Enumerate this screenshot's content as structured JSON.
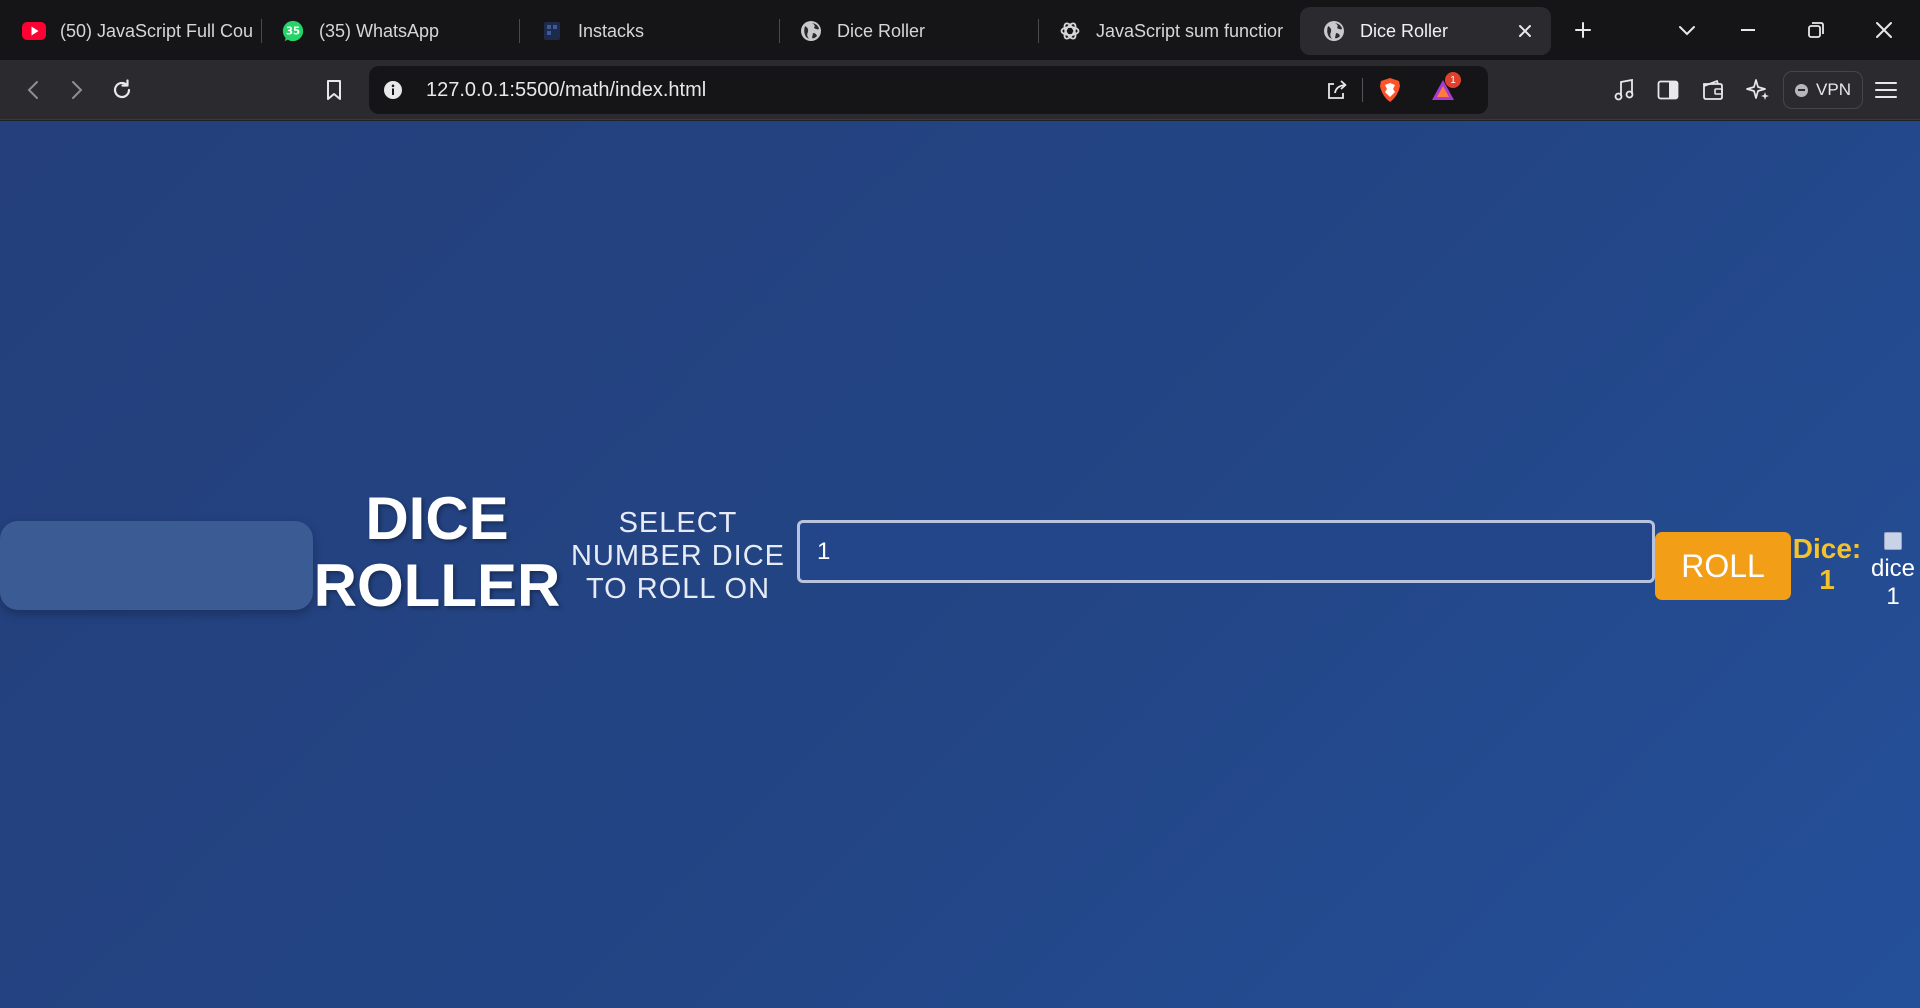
{
  "browser": {
    "tabs": [
      {
        "title": "(50) JavaScript Full Cou",
        "icon": "youtube-icon",
        "active": false
      },
      {
        "title": "(35) WhatsApp",
        "icon": "whatsapp-icon",
        "badge": "35",
        "active": false
      },
      {
        "title": "Instacks",
        "icon": "instacks-icon",
        "active": false
      },
      {
        "title": "Dice Roller",
        "icon": "globe-icon",
        "active": false
      },
      {
        "title": "JavaScript sum functior",
        "icon": "chatgpt-icon",
        "active": false
      },
      {
        "title": "Dice Roller",
        "icon": "globe-icon",
        "active": true
      }
    ],
    "address_bar": {
      "url": "127.0.0.1:5500/math/index.html"
    },
    "rewards_badge_count": "1",
    "vpn_label": "VPN",
    "colors": {
      "tabstrip": "#151517",
      "toolbar": "#2b2b2f",
      "youtube": "#ff0033",
      "whatsapp": "#25d366",
      "brave": "#fb542b"
    }
  },
  "page": {
    "title_lines": [
      "DICE",
      "ROLLER"
    ],
    "select_label_lines": [
      "SELECT",
      "NUMBER DICE",
      "TO ROLL ON"
    ],
    "input_value": "1",
    "roll_label": "ROLL",
    "result_label": "Dice:",
    "result_value": "1",
    "image_alt_lines": [
      "dice",
      "1"
    ],
    "colors": {
      "background": "#234585",
      "roll_button": "#f29e16",
      "result_text": "#f4c22a"
    }
  }
}
